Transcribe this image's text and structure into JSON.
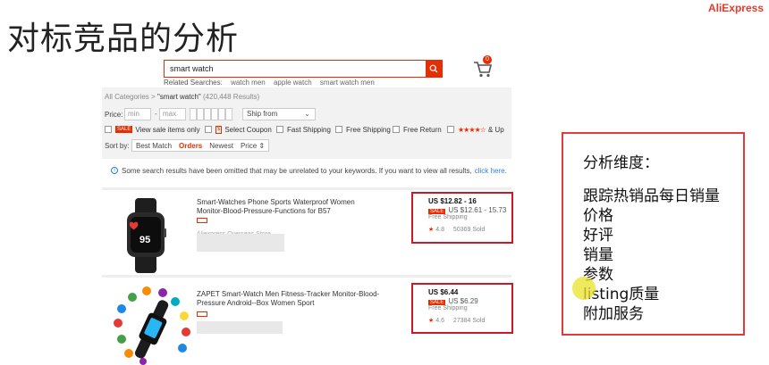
{
  "slide": {
    "title": "对标竞品的分析",
    "brand": "AliExpress"
  },
  "search": {
    "value": "smart watch",
    "cart_count": "0"
  },
  "related": {
    "label": "Related Searches:",
    "items": [
      "watch men",
      "apple watch",
      "smart watch men"
    ]
  },
  "filters": {
    "breadcrumb_root": "All Categories",
    "breadcrumb_sep": ">",
    "query_label": "\"smart watch\"",
    "results_count": "(420,448 Results)",
    "price_label": "Price:",
    "price_min_placeholder": "min",
    "price_dash": "-",
    "price_max_placeholder": "max",
    "ship_from": "Ship from",
    "checks": {
      "sale_tag": "SALE",
      "sale_label": "View sale items only",
      "coupon_tag": "$",
      "coupon_label": "Select Coupon",
      "fast_shipping": "Fast Shipping",
      "free_shipping": "Free Shipping",
      "free_return": "Free Return",
      "stars": "★★★★☆",
      "stars_label": "& Up"
    },
    "sort_label": "Sort by:",
    "sort_options": [
      "Best Match",
      "Orders",
      "Newest",
      "Price ⇕"
    ]
  },
  "notice": {
    "icon": "i",
    "text": "Some search results have been omitted that may be unrelated to your keywords. If you want to view all results,",
    "link": "click here."
  },
  "products": [
    {
      "title": "Smart-Watches Phone Sports Waterproof Women Monitor-Blood-Pressure-Functions for B57",
      "store": "Aliexpress Overseas Store",
      "price": "US $12.82 - 16",
      "sale_tag": "SALE",
      "sale_price": "US $12.61 - 15.73",
      "shipping": "Free Shipping",
      "rating": "4.8",
      "sold": "50369 Sold",
      "watch_display": "95"
    },
    {
      "title": "ZAPET Smart-Watch Men Fitness-Tracker Monitor-Blood-Pressure Android--Box Women Sport",
      "price": "US $6.44",
      "sale_tag": "SALE",
      "sale_price": "US $6.29",
      "shipping": "Free Shipping",
      "rating": "4.6",
      "sold": "27384 Sold"
    }
  ],
  "analysis": {
    "heading": "分析维度：",
    "items": [
      "跟踪热销品每日销量",
      "价格",
      "好评",
      "销量",
      "参数",
      "listing质量",
      "附加服务"
    ]
  },
  "colors": {
    "accent": "#e62e04",
    "frame": "#c91a26",
    "link": "#2c7ee8"
  }
}
